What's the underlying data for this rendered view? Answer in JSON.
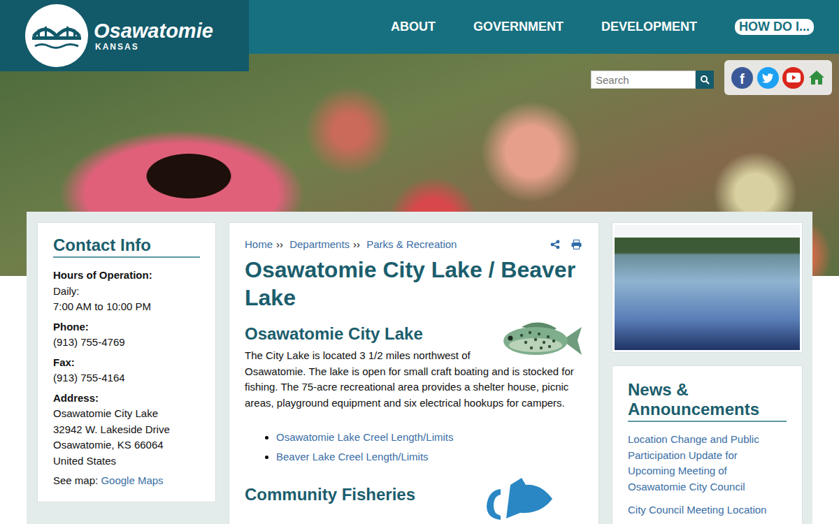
{
  "logo": {
    "name": "Osawatomie",
    "state": "KANSAS"
  },
  "nav": [
    {
      "label": "ABOUT",
      "highlighted": false
    },
    {
      "label": "GOVERNMENT",
      "highlighted": false
    },
    {
      "label": "DEVELOPMENT",
      "highlighted": false
    },
    {
      "label": "HOW DO I...",
      "highlighted": true
    }
  ],
  "search": {
    "placeholder": "Search"
  },
  "social": [
    {
      "kind": "facebook",
      "glyph": "f",
      "color": "#3b5998"
    },
    {
      "kind": "twitter",
      "glyph": "",
      "color": "#1da1f2"
    },
    {
      "kind": "youtube",
      "glyph": "",
      "color": "#d9261c"
    },
    {
      "kind": "home",
      "glyph": "",
      "color": "#2f8f3e"
    }
  ],
  "contact": {
    "title": "Contact Info",
    "fields": [
      {
        "label": "Hours of Operation:",
        "lines": [
          "Daily:",
          "7:00 AM to 10:00 PM"
        ]
      },
      {
        "label": "Phone:",
        "lines": [
          "(913) 755-4769"
        ]
      },
      {
        "label": "Fax:",
        "lines": [
          "(913) 755-4164"
        ]
      },
      {
        "label": "Address:",
        "lines": [
          "Osawatomie City Lake",
          "32942 W. Lakeside Drive",
          "Osawatomie, KS 66064",
          "United States"
        ]
      }
    ],
    "map": {
      "prefix": "See map:",
      "link": "Google Maps"
    }
  },
  "breadcrumb": {
    "items": [
      "Home",
      "Departments",
      "Parks & Recreation"
    ],
    "separator": "››"
  },
  "title": "Osawatomie City Lake / Beaver Lake",
  "section": {
    "heading": "Osawatomie City Lake",
    "body": "The City Lake is located 3 1/2 miles northwest of Osawatomie. The lake is open for small craft boating and is stocked for fishing. The 75-acre recreational area provides a shelter house, picnic areas, playground equipment and six electrical hookups for campers.",
    "links": [
      "Osawatomie Lake Creel Length/Limits",
      "Beaver Lake Creel Length/Limits"
    ]
  },
  "section2": {
    "heading": "Community Fisheries"
  },
  "news": {
    "title": "News & Announcements",
    "items": [
      "Location Change and Public Participation Update for Upcoming Meeting of Osawatomie City Council",
      "City Council Meeting Location"
    ]
  }
}
